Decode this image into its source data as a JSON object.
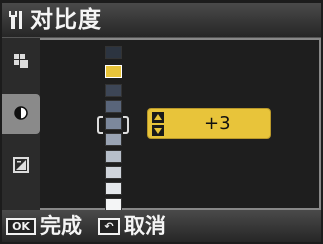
{
  "header": {
    "title": "对比度",
    "icon": "wrench-icon"
  },
  "tabs": [
    {
      "name": "setup-tab",
      "icon": "grid-icon",
      "selected": false
    },
    {
      "name": "contrast-tab",
      "icon": "contrast-icon",
      "selected": true
    },
    {
      "name": "brightness-tab",
      "icon": "exposure-icon",
      "selected": false
    }
  ],
  "contrast": {
    "value_text": "+3",
    "levels": 10,
    "selected_level_index": 1,
    "colors": {
      "highlight": "#e8c43a"
    }
  },
  "footer": {
    "ok_key": "OK",
    "ok_label": "完成",
    "back_key": "↶",
    "back_label": "取消"
  }
}
